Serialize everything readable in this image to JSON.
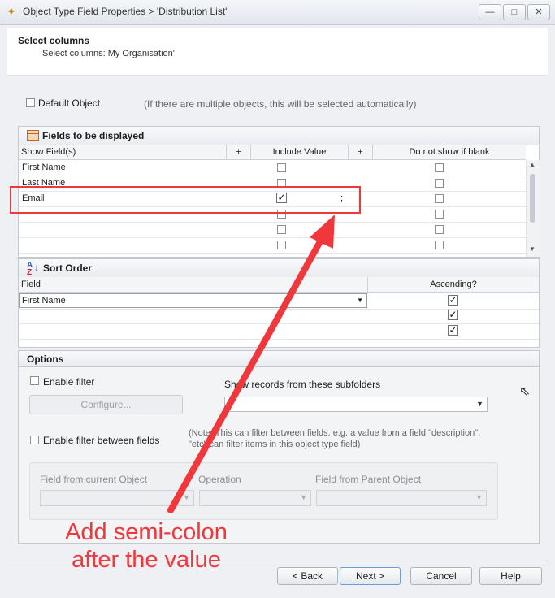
{
  "window": {
    "title": "Object Type Field Properties > 'Distribution List'",
    "minimize": "—",
    "maximize": "□",
    "close": "✕"
  },
  "header": {
    "title": "Select columns",
    "subtitle": "Select columns: My Organisation'"
  },
  "default_object": {
    "label": "Default Object",
    "hint": "(If there are multiple objects, this will be selected automatically)",
    "checked": false
  },
  "fields_group": {
    "title": "Fields to be displayed",
    "columns": {
      "show": "Show Field(s)",
      "plus1": "+",
      "include": "Include Value",
      "plus2": "+",
      "blank": "Do not show if blank"
    },
    "rows": [
      {
        "field": "First Name",
        "include": false,
        "suffix": "",
        "blank": false
      },
      {
        "field": "Last Name",
        "include": false,
        "suffix": "",
        "blank": false
      },
      {
        "field": "Email",
        "include": true,
        "suffix": ";",
        "blank": false
      },
      {
        "field": "",
        "include": false,
        "suffix": "",
        "blank": false
      },
      {
        "field": "",
        "include": false,
        "suffix": "",
        "blank": false
      },
      {
        "field": "",
        "include": false,
        "suffix": "",
        "blank": false
      }
    ]
  },
  "sort_group": {
    "title": "Sort Order",
    "columns": {
      "field": "Field",
      "ascending": "Ascending?"
    },
    "rows": [
      {
        "field": "First Name",
        "ascending": true
      },
      {
        "field": "",
        "ascending": true
      },
      {
        "field": "",
        "ascending": true
      }
    ]
  },
  "options_group": {
    "title": "Options",
    "enable_filter": "Enable filter",
    "configure": "Configure...",
    "subfolders_label": "Show records from these subfolders",
    "enable_filter_between": "Enable filter between fields",
    "note": "(Note: This can filter between fields. e.g. a value from a field \"description\", \"etc\" can filter items in this object type field)",
    "field_current": "Field from current Object",
    "operation": "Operation",
    "field_parent": "Field from Parent Object"
  },
  "annotation": {
    "text": "Add semi-colon after the value",
    "color": "#f0373c"
  },
  "buttons": {
    "back": "< Back",
    "next": "Next >",
    "cancel": "Cancel",
    "help": "Help"
  },
  "icons": {
    "check": "✓",
    "dropdown": "▼",
    "scroll_up": "▲",
    "scroll_down": "▼"
  }
}
